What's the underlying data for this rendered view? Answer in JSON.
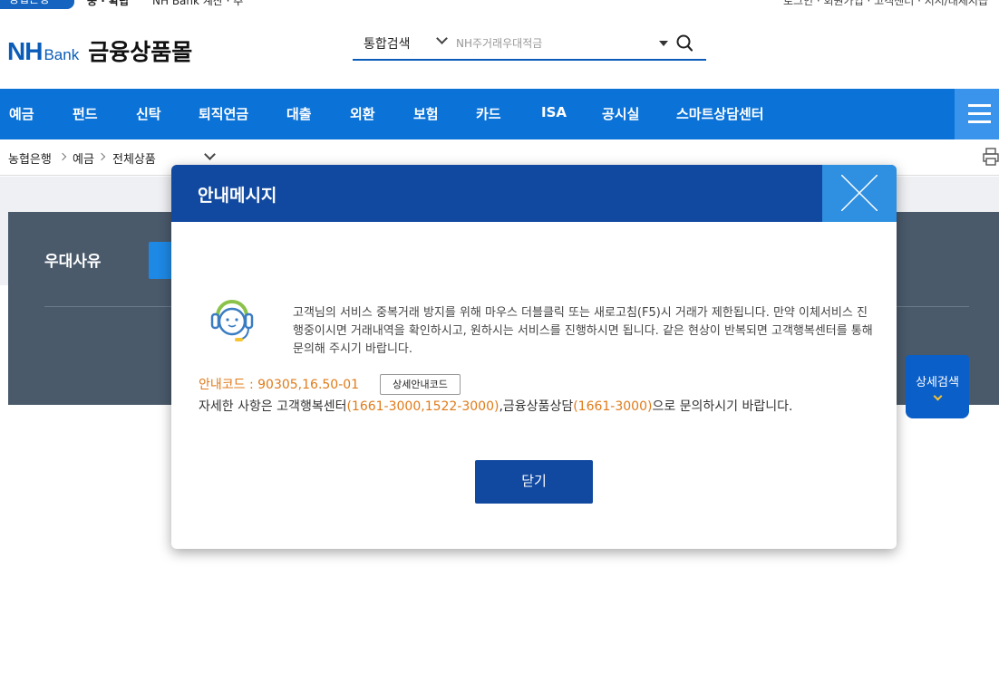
{
  "top_strip": {
    "badge": "농협은행",
    "item_1": "중 · 확립",
    "item_2": "NH Bank 계산 · 추",
    "right_links": "로그인 · 회원가입 · 고객센터 · 지시/대체지급"
  },
  "header": {
    "logo_nh": "NH",
    "logo_bank": "Bank",
    "logo_mall": "금융상품몰",
    "search": {
      "category": "통합검색",
      "placeholder": "NH주거래우대적금"
    }
  },
  "nav": {
    "items": [
      "예금",
      "펀드",
      "신탁",
      "퇴직연금",
      "대출",
      "외환",
      "보험",
      "카드",
      "ISA",
      "공시실",
      "스마트상담센터"
    ]
  },
  "breadcrumb": {
    "items": [
      "농협은행",
      "예금",
      "전체상품"
    ]
  },
  "page": {
    "panel_label": "우대사유",
    "detail_search": "상세검색"
  },
  "modal": {
    "title": "안내메시지",
    "message": "고객님의 서비스 중복거래 방지를 위해 마우스 더블클릭 또는 새로고침(F5)시 거래가 제한됩니다. 만약 이체서비스 진행중이시면 거래내역을 확인하시고, 원하시는 서비스를 진행하시면 됩니다. 같은 현상이 반복되면 고객행복센터를 통해 문의해 주시기 바랍니다.",
    "code_label": "안내코드 : 90305,16.50-01",
    "code_button": "상세안내코드",
    "contact_prefix": "자세한 사항은 고객행복센터",
    "contact_center_number": "(1661-3000,1522-3000)",
    "contact_middle": ",금융상품상담",
    "contact_product_number": "(1661-3000)",
    "contact_suffix": "으로 문의하시기 바랍니다.",
    "close_button": "닫기"
  },
  "colors": {
    "brand_blue": "#0b73d8",
    "modal_header": "#1149a0",
    "modal_close": "#2f8fe0",
    "highlight_orange": "#e07b1a"
  }
}
